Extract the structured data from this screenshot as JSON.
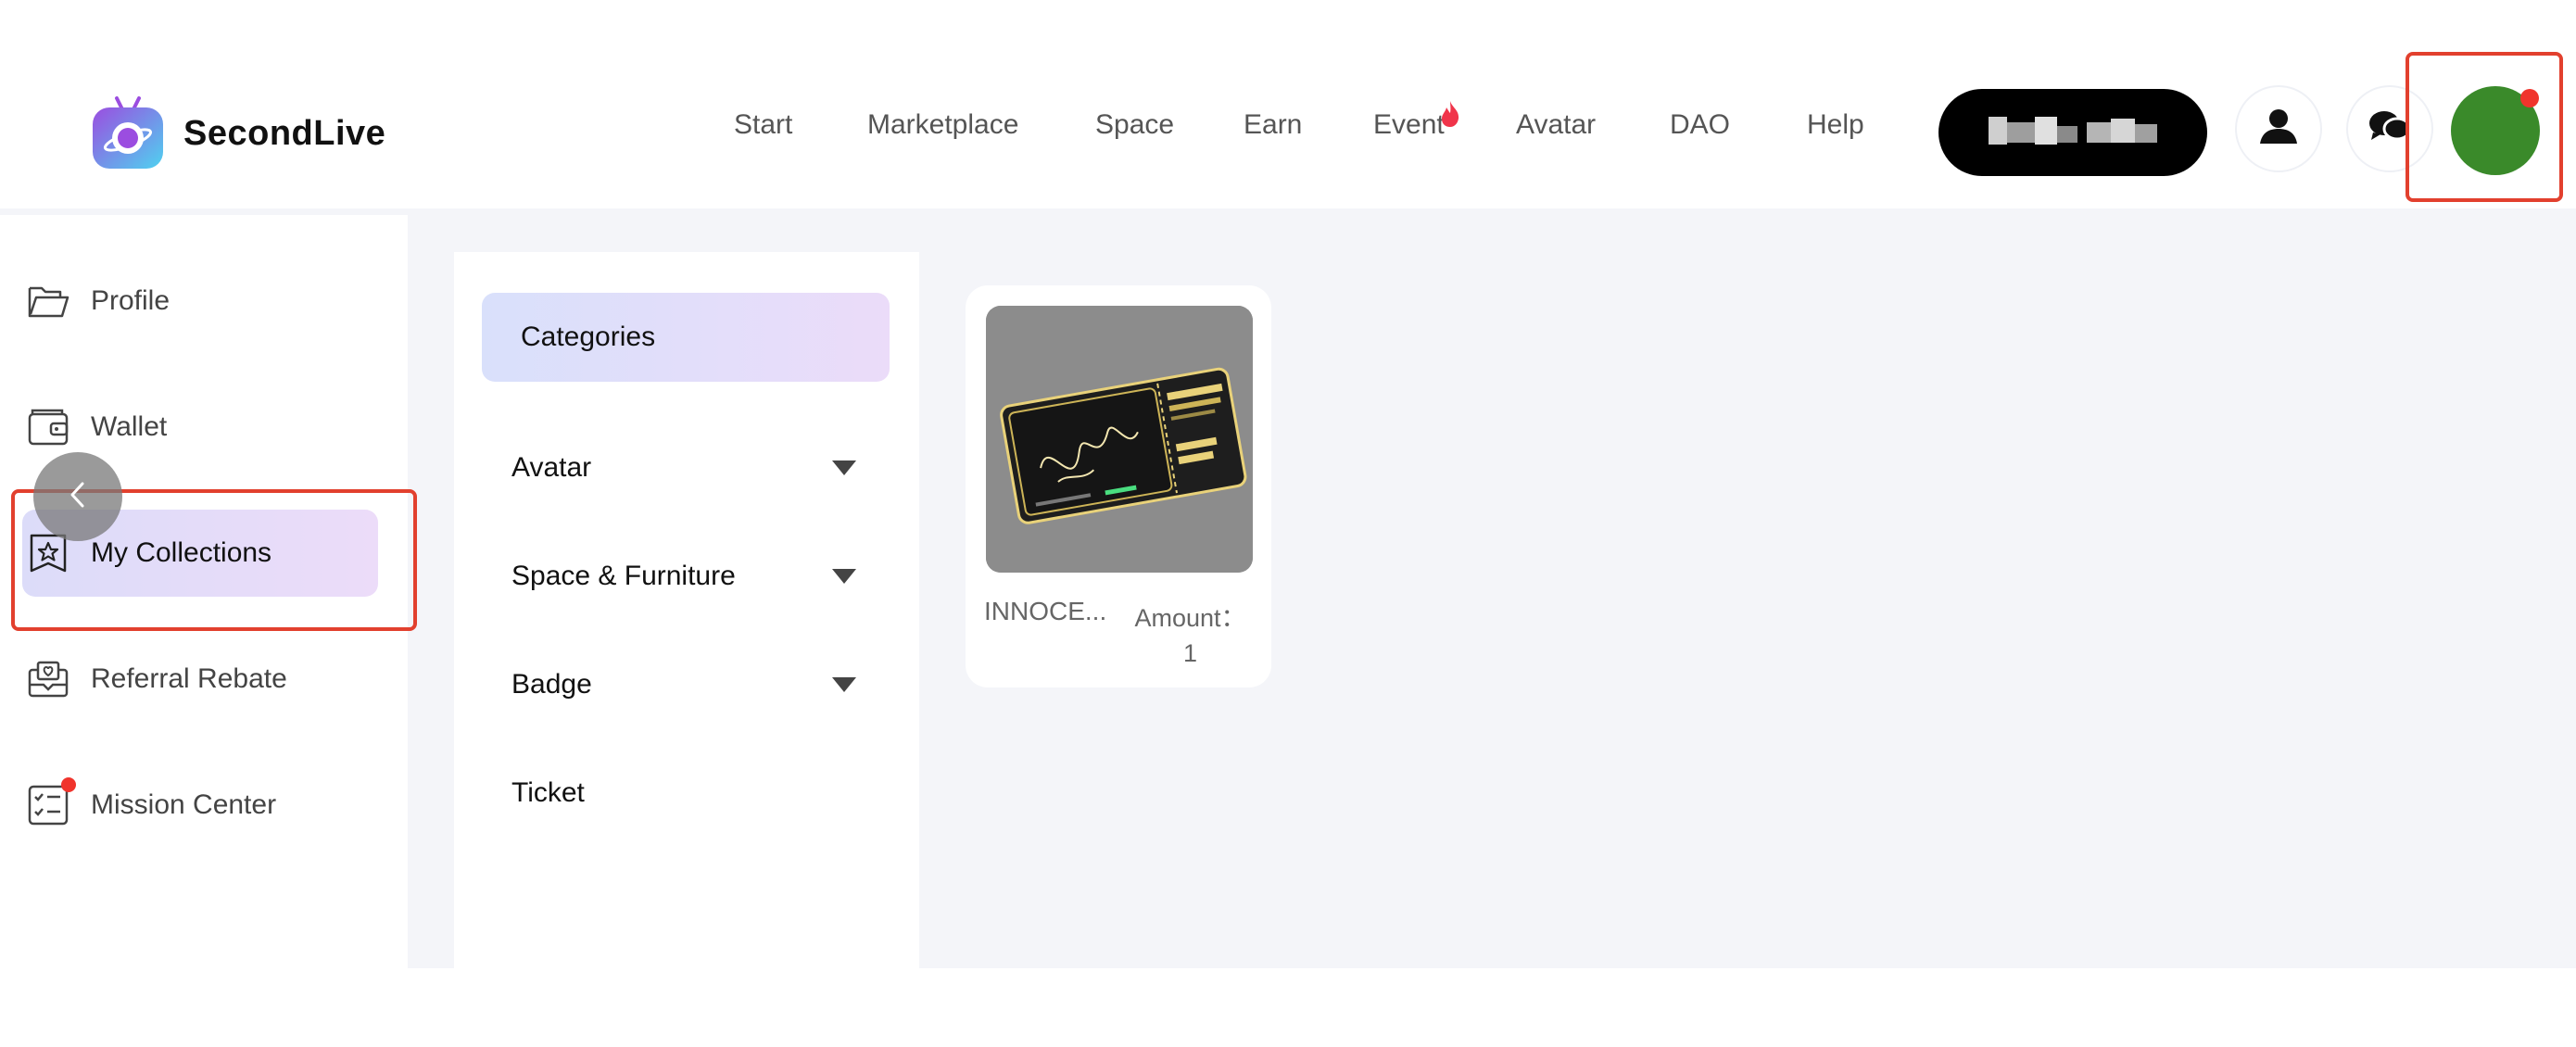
{
  "app": {
    "name": "SecondLive"
  },
  "nav": {
    "items": [
      {
        "label": "Start"
      },
      {
        "label": "Marketplace"
      },
      {
        "label": "Space"
      },
      {
        "label": "Earn"
      },
      {
        "label": "Event",
        "badge": "flame-icon"
      },
      {
        "label": "Avatar"
      },
      {
        "label": "DAO"
      },
      {
        "label": "Help"
      }
    ]
  },
  "header": {
    "wallet_address": "",
    "icons": [
      "user-icon",
      "chat-icon"
    ],
    "avatar_color": "#3a8a2a",
    "notification_color": "#f0342c"
  },
  "sidebar": {
    "items": [
      {
        "label": "Profile",
        "icon": "folder-icon"
      },
      {
        "label": "Wallet",
        "icon": "wallet-icon"
      },
      {
        "label": "My Collections",
        "icon": "collection-star-icon",
        "active": true
      },
      {
        "label": "Referral Rebate",
        "icon": "gift-envelope-icon"
      },
      {
        "label": "Mission Center",
        "icon": "checklist-icon",
        "badge": true
      }
    ]
  },
  "categories": {
    "title": "Categories",
    "items": [
      {
        "label": "Avatar",
        "expandable": true
      },
      {
        "label": "Space & Furniture",
        "expandable": true
      },
      {
        "label": "Badge",
        "expandable": true
      },
      {
        "label": "Ticket",
        "expandable": false
      }
    ]
  },
  "collection": {
    "items": [
      {
        "name": "INNOCE...",
        "amount_label": "Amount：",
        "amount": "1",
        "image": "metaverse concert ticket pass"
      }
    ]
  },
  "colors": {
    "accent_gradient_start": "#dcdcf9",
    "accent_gradient_end": "#ecdcf9",
    "highlight_box": "#e2402e"
  }
}
